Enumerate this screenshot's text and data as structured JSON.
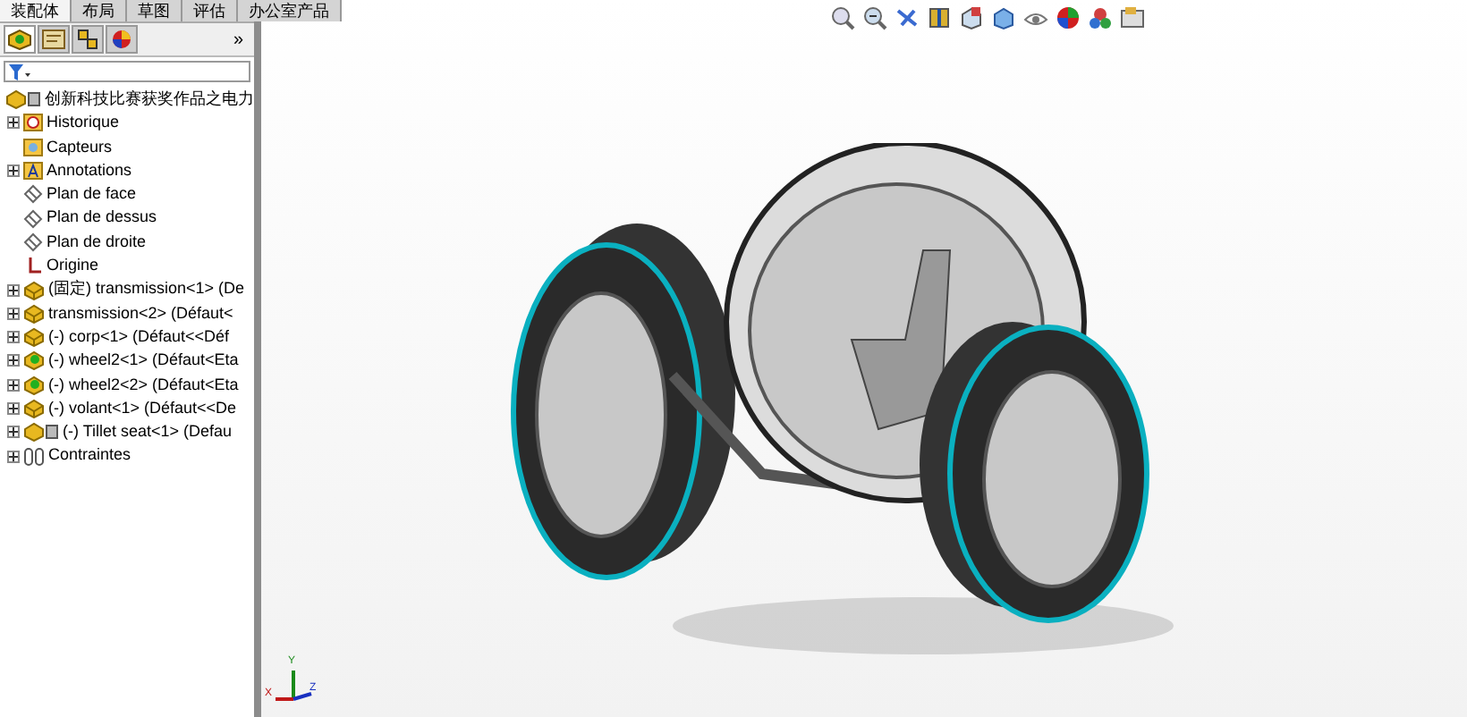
{
  "tabs": [
    {
      "label": "装配体",
      "selected": true
    },
    {
      "label": "布局",
      "selected": false
    },
    {
      "label": "草图",
      "selected": false
    },
    {
      "label": "评估",
      "selected": false
    },
    {
      "label": "办公室产品",
      "selected": false
    }
  ],
  "panel": {
    "tabs": [
      {
        "kind": "tree",
        "selected": true
      },
      {
        "kind": "property",
        "selected": false
      },
      {
        "kind": "config",
        "selected": false
      },
      {
        "kind": "appearance",
        "selected": false
      }
    ],
    "more": "»"
  },
  "tree": {
    "root": "创新科技比赛获奖作品之电力",
    "items": [
      {
        "kind": "history",
        "label": "Historique",
        "expandable": true
      },
      {
        "kind": "sensor",
        "label": "Capteurs",
        "expandable": false
      },
      {
        "kind": "annotation",
        "label": "Annotations",
        "expandable": true
      },
      {
        "kind": "plane",
        "label": "Plan de face",
        "expandable": false
      },
      {
        "kind": "plane",
        "label": "Plan de dessus",
        "expandable": false
      },
      {
        "kind": "plane",
        "label": "Plan de droite",
        "expandable": false
      },
      {
        "kind": "origin",
        "label": "Origine",
        "expandable": false
      },
      {
        "kind": "part",
        "label": "(固定) transmission<1> (De",
        "expandable": true
      },
      {
        "kind": "part",
        "label": "transmission<2> (Défaut<",
        "expandable": true
      },
      {
        "kind": "part",
        "label": "(-) corp<1> (Défaut<<Déf",
        "expandable": true
      },
      {
        "kind": "part-green",
        "label": "(-) wheel2<1> (Défaut<Eta",
        "expandable": true
      },
      {
        "kind": "part-green",
        "label": "(-) wheel2<2> (Défaut<Eta",
        "expandable": true
      },
      {
        "kind": "part",
        "label": "(-) volant<1> (Défaut<<De",
        "expandable": true
      },
      {
        "kind": "part-sub",
        "label": "(-) Tillet seat<1> (Defau",
        "expandable": true
      },
      {
        "kind": "mates",
        "label": "Contraintes",
        "expandable": true
      }
    ]
  },
  "triad": {
    "x": "X",
    "y": "Y",
    "z": "Z"
  }
}
